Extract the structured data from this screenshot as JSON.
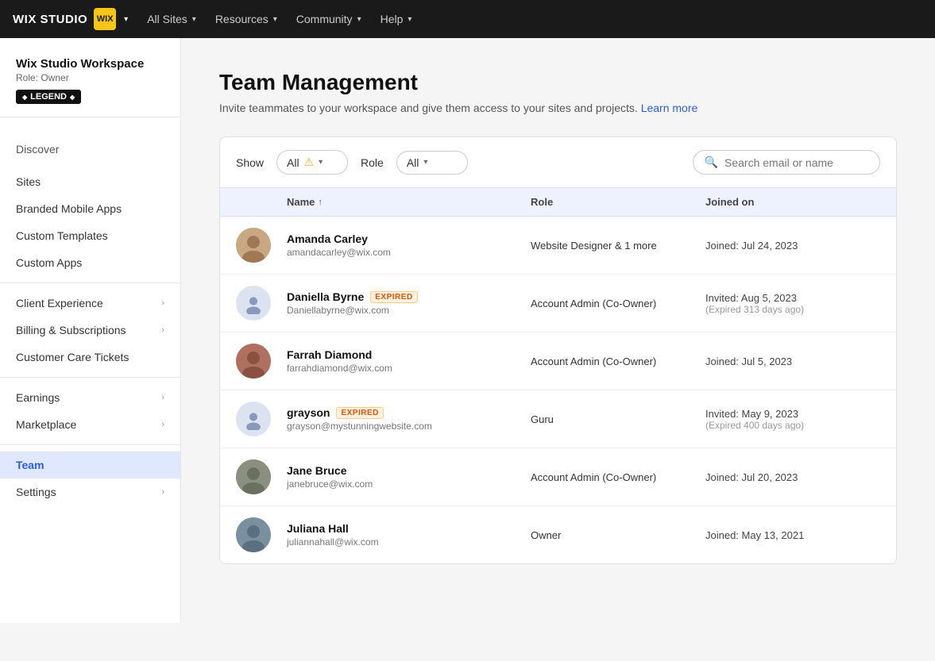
{
  "topNav": {
    "brand": "WIX STUDIO",
    "brandIcon": "WIX",
    "allSites": "All Sites",
    "resources": "Resources",
    "community": "Community",
    "help": "Help"
  },
  "sidebar": {
    "workspaceName": "Wix Studio Workspace",
    "workspaceRole": "Role: Owner",
    "legendBadge": "◆ LEGEND ◆",
    "discoverLabel": "Discover",
    "items": [
      {
        "id": "sites",
        "label": "Sites",
        "hasChevron": false
      },
      {
        "id": "branded-mobile-apps",
        "label": "Branded Mobile Apps",
        "hasChevron": false
      },
      {
        "id": "custom-templates",
        "label": "Custom Templates",
        "hasChevron": false
      },
      {
        "id": "custom-apps",
        "label": "Custom Apps",
        "hasChevron": false
      },
      {
        "id": "client-experience",
        "label": "Client Experience",
        "hasChevron": true
      },
      {
        "id": "billing-subscriptions",
        "label": "Billing & Subscriptions",
        "hasChevron": true
      },
      {
        "id": "customer-care-tickets",
        "label": "Customer Care Tickets",
        "hasChevron": false
      },
      {
        "id": "earnings",
        "label": "Earnings",
        "hasChevron": true
      },
      {
        "id": "marketplace",
        "label": "Marketplace",
        "hasChevron": true
      },
      {
        "id": "team",
        "label": "Team",
        "hasChevron": false,
        "active": true
      },
      {
        "id": "settings",
        "label": "Settings",
        "hasChevron": true
      }
    ]
  },
  "page": {
    "title": "Team Management",
    "subtitle": "Invite teammates to your workspace and give them access to your sites and projects.",
    "learnMore": "Learn more"
  },
  "filters": {
    "showLabel": "Show",
    "showValue": "All",
    "roleLabel": "Role",
    "roleValue": "All",
    "searchPlaceholder": "Search email or name"
  },
  "table": {
    "columns": {
      "name": "Name",
      "role": "Role",
      "joinedOn": "Joined on"
    },
    "members": [
      {
        "id": "amanda-carley",
        "name": "Amanda Carley",
        "email": "amandacarley@wix.com",
        "role": "Website Designer & 1 more",
        "joined": "Joined: Jul 24, 2023",
        "expired": false,
        "hasPhoto": true,
        "photoColor": "#c8a882"
      },
      {
        "id": "daniella-byrne",
        "name": "Daniella Byrne",
        "email": "Daniellabyrne@wix.com",
        "role": "Account Admin (Co-Owner)",
        "joined": "Invited: Aug 5, 2023",
        "expiredNote": "(Expired 313 days ago)",
        "expired": true,
        "hasPhoto": false
      },
      {
        "id": "farrah-diamond",
        "name": "Farrah Diamond",
        "email": "farrahdiamond@wix.com",
        "role": "Account Admin (Co-Owner)",
        "joined": "Joined: Jul 5, 2023",
        "expired": false,
        "hasPhoto": true,
        "photoColor": "#b07060"
      },
      {
        "id": "grayson",
        "name": "grayson",
        "email": "grayson@mystunningwebsite.com",
        "role": "Guru",
        "joined": "Invited: May 9, 2023",
        "expiredNote": "(Expired 400 days ago)",
        "expired": true,
        "hasPhoto": false
      },
      {
        "id": "jane-bruce",
        "name": "Jane Bruce",
        "email": "janebruce@wix.com",
        "role": "Account Admin (Co-Owner)",
        "joined": "Joined: Jul 20, 2023",
        "expired": false,
        "hasPhoto": true,
        "photoColor": "#8a7060"
      },
      {
        "id": "juliana-hall",
        "name": "Juliana Hall",
        "email": "juliannahall@wix.com",
        "role": "Owner",
        "joined": "Joined: May 13, 2021",
        "expired": false,
        "hasPhoto": true,
        "photoColor": "#7a90a0"
      }
    ]
  }
}
